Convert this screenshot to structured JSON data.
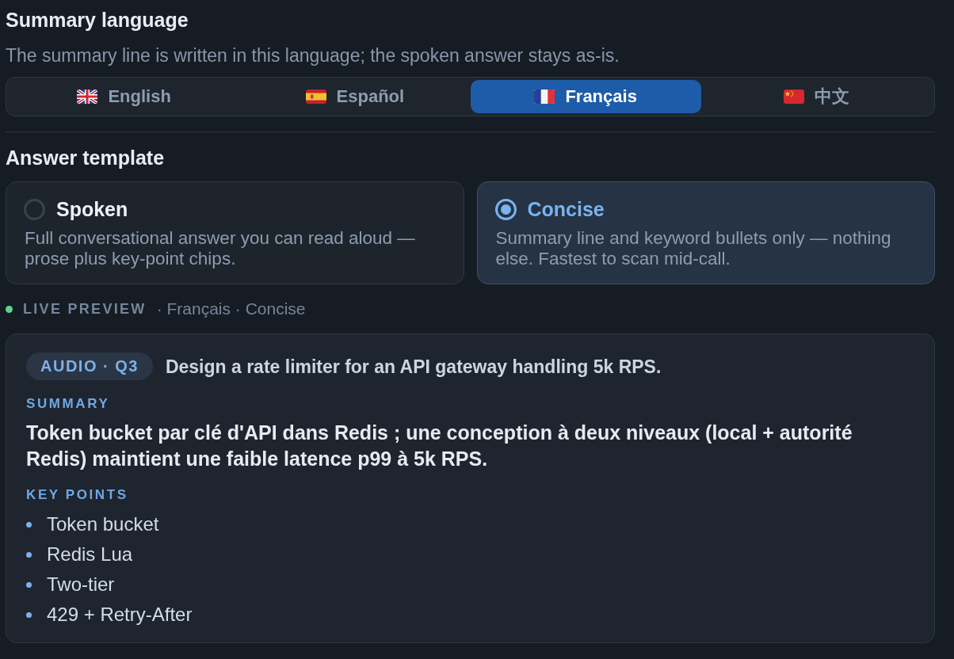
{
  "summary_language": {
    "title": "Summary language",
    "description": "The summary line is written in this language; the spoken answer stays as-is.",
    "options": [
      {
        "label": "English",
        "kind": "gb",
        "selected": false
      },
      {
        "label": "Español",
        "kind": "es",
        "selected": false
      },
      {
        "label": "Français",
        "kind": "fr",
        "selected": true
      },
      {
        "label": "中文",
        "kind": "cn",
        "selected": false
      }
    ]
  },
  "answer_template": {
    "title": "Answer template",
    "options": [
      {
        "title": "Spoken",
        "description": "Full conversational answer you can read aloud — prose plus key-point chips.",
        "selected": false
      },
      {
        "title": "Concise",
        "description": "Summary line and keyword bullets only — nothing else. Fastest to scan mid-call.",
        "selected": true
      }
    ]
  },
  "live_preview": {
    "label": "LIVE PREVIEW",
    "live": true,
    "context": "· Français · Concise"
  },
  "preview": {
    "badge": "AUDIO · Q3",
    "question": "Design a rate limiter for an API gateway handling 5k RPS.",
    "summary_label": "SUMMARY",
    "summary": "Token bucket par clé d'API dans Redis ; une conception à deux niveaux (local + autorité Redis) maintient une faible latence p99 à 5k RPS.",
    "key_points_label": "KEY POINTS",
    "key_points": [
      "Token bucket",
      "Redis Lua",
      "Two-tier",
      "429 + Retry-After"
    ]
  }
}
